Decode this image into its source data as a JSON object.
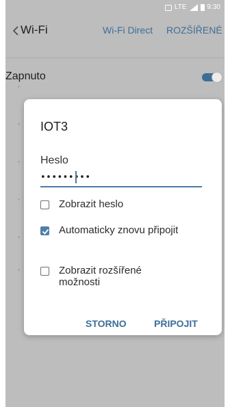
{
  "statusbar": {
    "network": "LTE",
    "time": "9:30"
  },
  "toolbar": {
    "title": "Wi-Fi",
    "wifi_direct": "Wi-Fi Direct",
    "advanced": "ROZŠÍŘENÉ"
  },
  "switch_row": {
    "label": "Zapnuto",
    "on": true
  },
  "dialog": {
    "title": "IOT3",
    "password_label": "Heslo",
    "password_value": "•••••••••",
    "options": [
      {
        "label": "Zobrazit heslo",
        "checked": false
      },
      {
        "label": "Automaticky znovu připojit",
        "checked": true
      },
      {
        "label": "Zobrazit rozšířené možnosti",
        "checked": false
      }
    ],
    "cancel_label": "STORNO",
    "connect_label": "PŘIPOJIT"
  },
  "colors": {
    "accent": "#3c6e94",
    "dim_overlay": "#bdbdbd"
  }
}
